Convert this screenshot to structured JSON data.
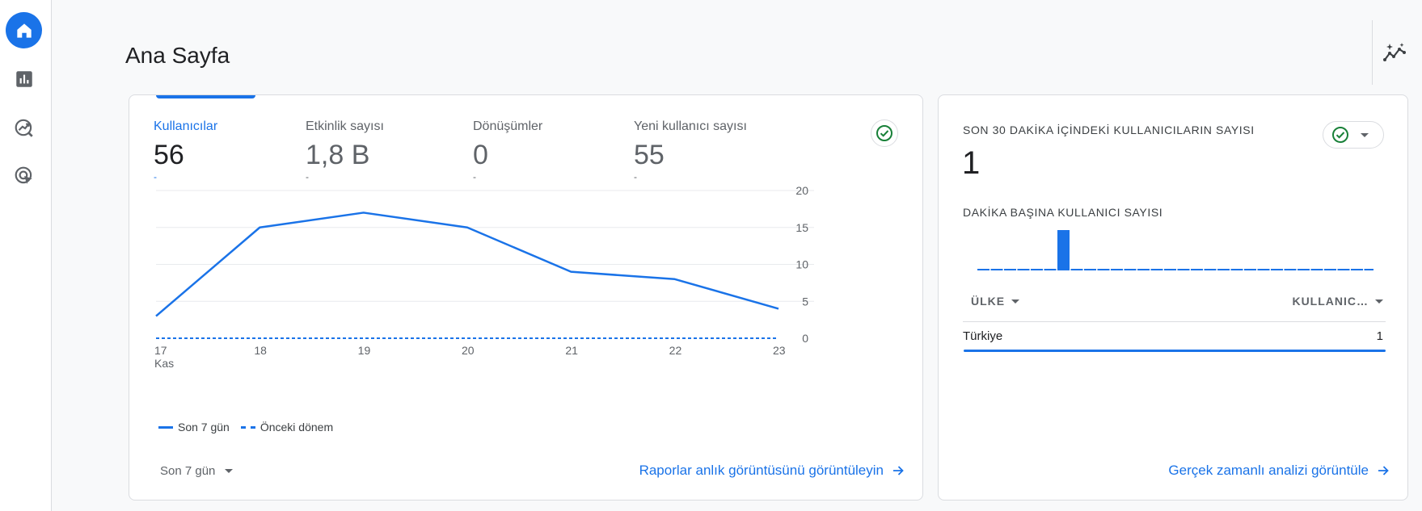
{
  "page": {
    "title": "Ana Sayfa"
  },
  "nav": {
    "items": [
      {
        "name": "home",
        "icon": "home-icon",
        "active": true
      },
      {
        "name": "reports",
        "icon": "bar-chart-icon",
        "active": false
      },
      {
        "name": "explore",
        "icon": "explore-icon",
        "active": false
      },
      {
        "name": "advertising",
        "icon": "cursor-target-icon",
        "active": false
      }
    ]
  },
  "overview": {
    "metrics": [
      {
        "label": "Kullanıcılar",
        "value": "56",
        "delta": "-",
        "active": true
      },
      {
        "label": "Etkinlik sayısı",
        "value": "1,8 B",
        "delta": "-",
        "active": false
      },
      {
        "label": "Dönüşümler",
        "value": "0",
        "delta": "-",
        "active": false
      },
      {
        "label": "Yeni kullanıcı sayısı",
        "value": "55",
        "delta": "-",
        "active": false
      }
    ],
    "legend": {
      "current": "Son 7 gün",
      "previous": "Önceki dönem"
    },
    "date_range": "Son 7 gün",
    "link": "Raporlar anlık görüntüsünü görüntüleyin"
  },
  "chart_data": {
    "type": "line",
    "x": [
      "17",
      "18",
      "19",
      "20",
      "21",
      "22",
      "23"
    ],
    "x_sublabel": "Kas",
    "series": [
      {
        "name": "Son 7 gün",
        "values": [
          3,
          15,
          17,
          15,
          9,
          8,
          4
        ],
        "style": "solid",
        "color": "#1a73e8"
      },
      {
        "name": "Önceki dönem",
        "values": [
          0,
          0,
          0,
          0,
          0,
          0,
          0
        ],
        "style": "dashed",
        "color": "#1a73e8"
      }
    ],
    "yticks": [
      0,
      5,
      10,
      15,
      20
    ],
    "ylim": [
      0,
      20
    ],
    "grid": true,
    "y_axis_side": "right",
    "legend_position": "bottom-left"
  },
  "realtime": {
    "title": "SON 30 DAKİKA İÇİNDEKİ KULLANICILARIN SAYISI",
    "value": "1",
    "per_minute_title": "DAKİKA BAŞINA KULLANICI SAYISI",
    "per_minute": [
      0,
      0,
      0,
      0,
      0,
      0,
      1,
      0,
      0,
      0,
      0,
      0,
      0,
      0,
      0,
      0,
      0,
      0,
      0,
      0,
      0,
      0,
      0,
      0,
      0,
      0,
      0,
      0,
      0,
      0
    ],
    "table": {
      "col1": "ÜLKE",
      "col2": "KULLANIC…",
      "rows": [
        {
          "country": "Türkiye",
          "value": "1",
          "share": 1.0
        }
      ]
    },
    "link": "Gerçek zamanlı analizi görüntüle"
  },
  "colors": {
    "accent": "#1a73e8",
    "success": "#188038",
    "border": "#dadce0"
  }
}
